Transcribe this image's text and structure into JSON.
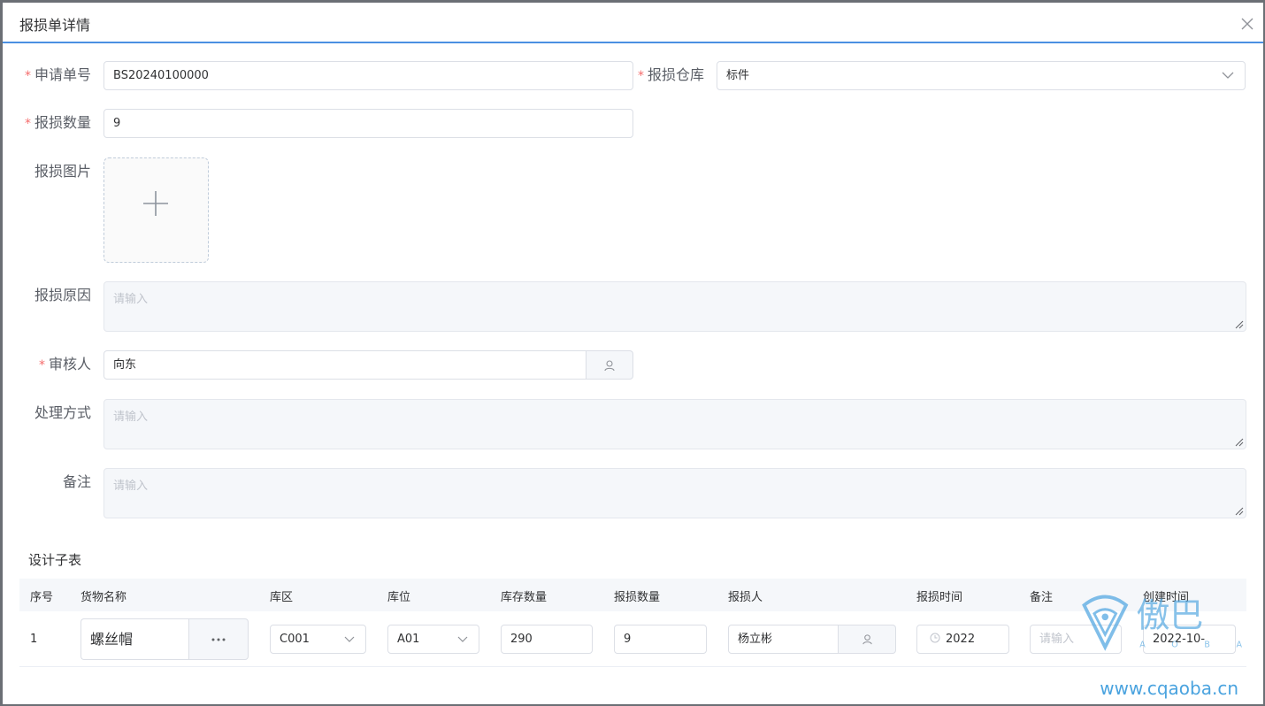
{
  "dialog": {
    "title": "报损单详情"
  },
  "form": {
    "order_no": {
      "label": "申请单号",
      "value": "BS20240100000"
    },
    "warehouse": {
      "label": "报损仓库",
      "value": "标件"
    },
    "quantity": {
      "label": "报损数量",
      "value": "9"
    },
    "image": {
      "label": "报损图片"
    },
    "reason": {
      "label": "报损原因",
      "placeholder": "请输入"
    },
    "reviewer": {
      "label": "审核人",
      "value": "向东"
    },
    "method": {
      "label": "处理方式",
      "placeholder": "请输入"
    },
    "remark": {
      "label": "备注",
      "placeholder": "请输入"
    }
  },
  "subtable": {
    "title": "设计子表",
    "headers": [
      "序号",
      "货物名称",
      "库区",
      "库位",
      "库存数量",
      "报损数量",
      "报损人",
      "报损时间",
      "备注",
      "创建时间"
    ],
    "rows": [
      {
        "index": "1",
        "goods": "螺丝帽",
        "zone": "C001",
        "location": "A01",
        "stock": "290",
        "loss_qty": "9",
        "person": "杨立彬",
        "loss_time": "2022",
        "remark_placeholder": "请输入",
        "created": "2022-10-"
      }
    ]
  },
  "watermark": {
    "brand": "傲巴",
    "letters": "A O B A",
    "url": "www.cqaoba.cn"
  },
  "colors": {
    "accent": "#4a90e2",
    "required": "#f56c6c",
    "watermark": "#4aa3df"
  }
}
